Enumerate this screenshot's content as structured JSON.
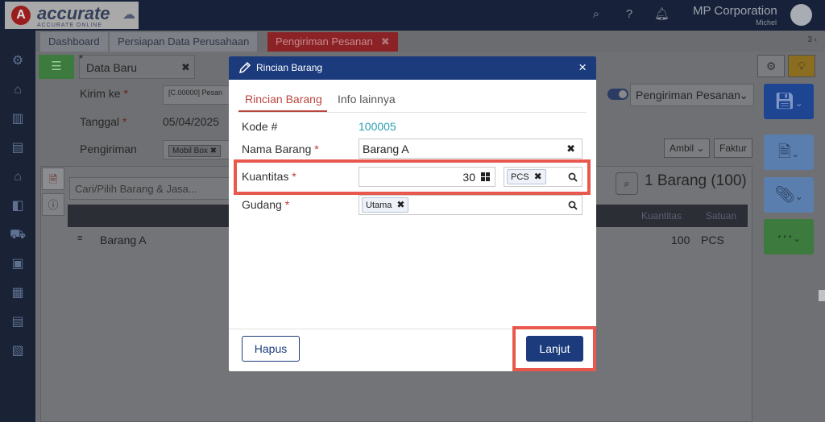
{
  "app": {
    "logo_text": "accurate",
    "logo_sub": "ACCURATE ONLINE",
    "company": "MP Corporation",
    "user": "Michel"
  },
  "tabs": [
    {
      "label": "Dashboard"
    },
    {
      "label": "Persiapan Data Perusahaan"
    },
    {
      "label": "Pengiriman Pesanan"
    }
  ],
  "tabs_right": "3 ‹",
  "document": {
    "tab_marker": "*",
    "tab_label": "Data Baru",
    "fields": {
      "kirim_ke_label": "Kirim ke",
      "kirim_ke_value": "[C.00000] Pesan",
      "tanggal_label": "Tanggal",
      "tanggal_value": "05/04/2025",
      "pengiriman_label": "Pengiriman",
      "pengiriman_value": "Mobil Box"
    },
    "type_select": "Pengiriman Pesanan",
    "ambil_label": "Ambil",
    "faktur_label": "Faktur",
    "search_placeholder": "Cari/Pilih Barang & Jasa...",
    "count_label": "1 Barang (100)",
    "table_headers": [
      "Kuantitas",
      "Satuan"
    ],
    "rows": [
      {
        "name": "Barang A",
        "qty": "100",
        "unit": "PCS"
      }
    ]
  },
  "modal": {
    "title": "Rincian Barang",
    "tabs": [
      "Rincian Barang",
      "Info lainnya"
    ],
    "kode_label": "Kode #",
    "kode_value": "100005",
    "nama_label": "Nama Barang",
    "nama_value": "Barang A",
    "kuantitas_label": "Kuantitas",
    "kuantitas_value": "30",
    "unit_chip": "PCS",
    "gudang_label": "Gudang",
    "gudang_chip": "Utama",
    "hapus_label": "Hapus",
    "lanjut_label": "Lanjut",
    "required_mark": "*"
  },
  "colors": {
    "header_blue": "#1b3b7d",
    "active_tab": "#b8463f",
    "link": "#2a9fb6",
    "highlight": "#e8584d"
  }
}
